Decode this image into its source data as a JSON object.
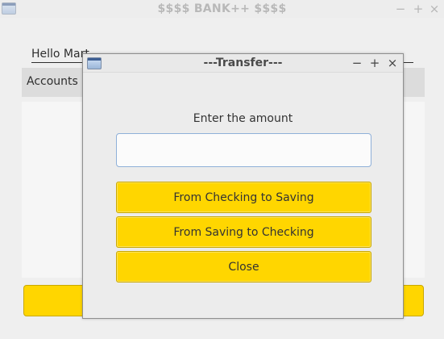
{
  "main_window": {
    "title": "$$$$ BANK++ $$$$",
    "controls": {
      "minimize": "−",
      "maximize": "+",
      "close": "×"
    },
    "greeting": "Hello Mart",
    "accounts_label": "Accounts"
  },
  "dialog": {
    "title": "---Transfer---",
    "controls": {
      "minimize": "−",
      "maximize": "+",
      "close": "×"
    },
    "prompt": "Enter the amount",
    "amount_value": "",
    "buttons": {
      "checking_to_saving": "From Checking to Saving",
      "saving_to_checking": "From Saving to Checking",
      "close": "Close"
    }
  },
  "colors": {
    "button_yellow": "#ffd600",
    "background": "#efefef",
    "input_border": "#8fb0d9"
  }
}
